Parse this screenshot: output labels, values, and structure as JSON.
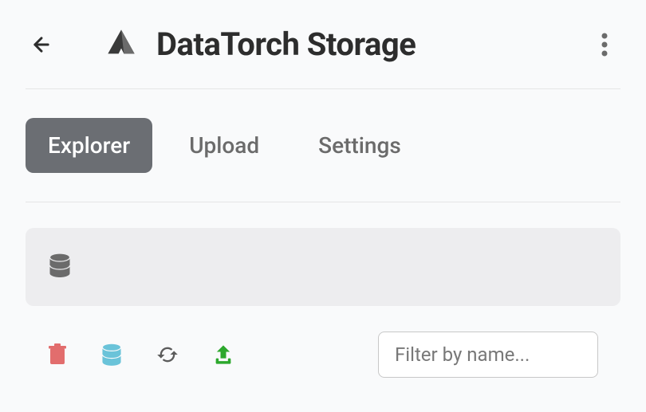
{
  "header": {
    "title": "DataTorch Storage"
  },
  "tabs": [
    {
      "label": "Explorer",
      "active": true
    },
    {
      "label": "Upload",
      "active": false
    },
    {
      "label": "Settings",
      "active": false
    }
  ],
  "filter": {
    "placeholder": "Filter by name..."
  },
  "icons": {
    "back": "arrow-left",
    "logo": "triangle-logo",
    "menu": "dots-vertical",
    "breadcrumb": "database",
    "delete": "trash",
    "storage": "database",
    "refresh": "sync",
    "upload": "upload"
  },
  "colors": {
    "delete": "#e26d6d",
    "storage": "#6ac3d9",
    "refresh": "#5c5c5c",
    "upload": "#2da82d"
  }
}
